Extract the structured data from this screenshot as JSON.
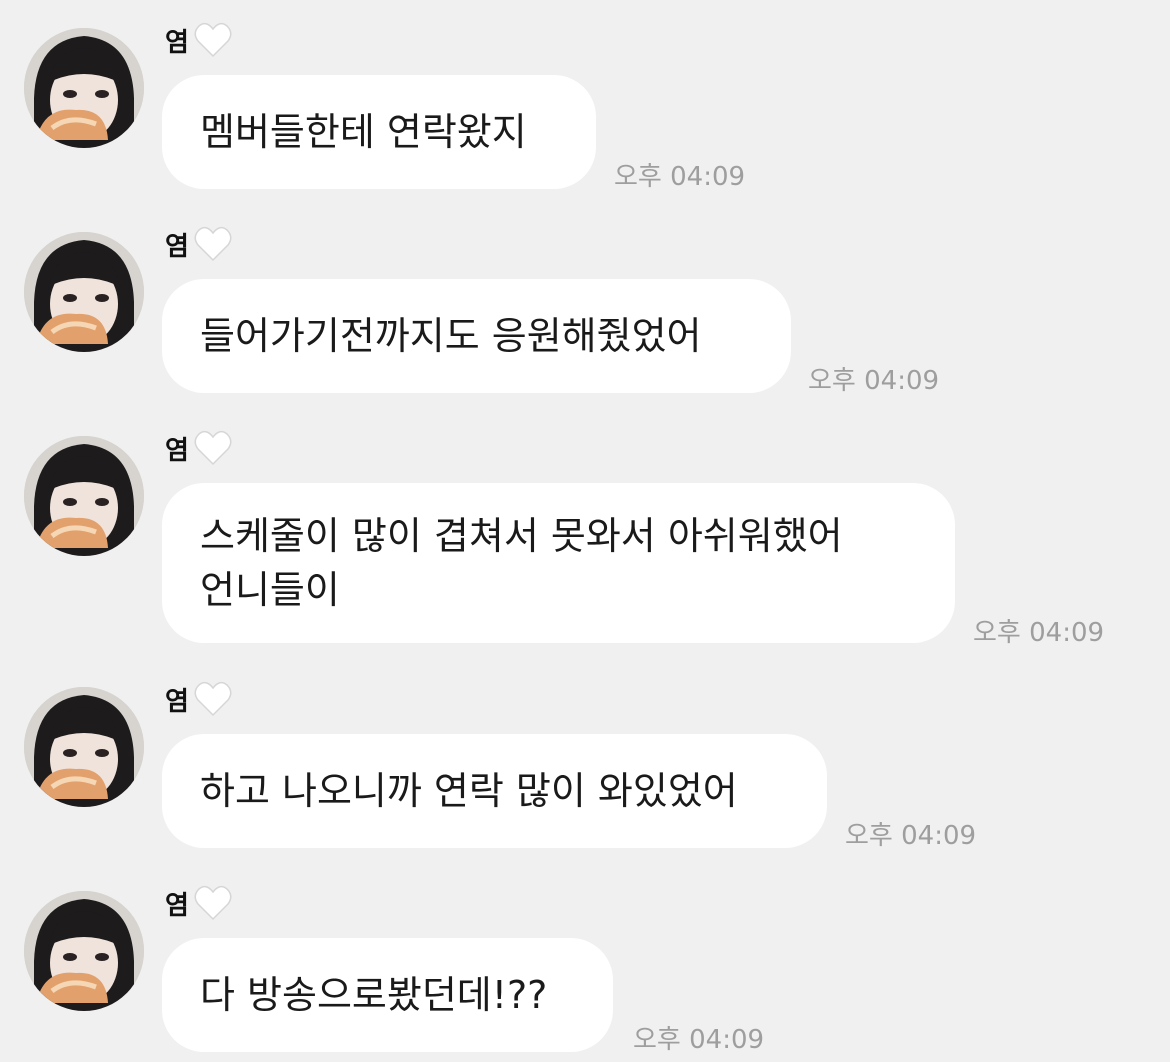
{
  "messages": [
    {
      "sender": "염",
      "lines": [
        "멤버들한테 연락왔지"
      ],
      "time": "오후 04:09"
    },
    {
      "sender": "염",
      "lines": [
        "들어가기전까지도 응원해줬었어"
      ],
      "time": "오후 04:09"
    },
    {
      "sender": "염",
      "lines": [
        "스케줄이 많이 겹쳐서 못와서 아쉬워했어",
        "언니들이"
      ],
      "time": "오후 04:09"
    },
    {
      "sender": "염",
      "lines": [
        "하고 나오니까 연락 많이 와있었어"
      ],
      "time": "오후 04:09"
    },
    {
      "sender": "염",
      "lines": [
        "다 방송으로봤던데!??"
      ],
      "time": "오후 04:09"
    }
  ],
  "icons": {
    "avatar": "profile-photo",
    "sender_badge": "white-heart-icon"
  },
  "colors": {
    "background": "#f0f0f0",
    "bubble": "#ffffff",
    "time": "#9e9e9e"
  }
}
